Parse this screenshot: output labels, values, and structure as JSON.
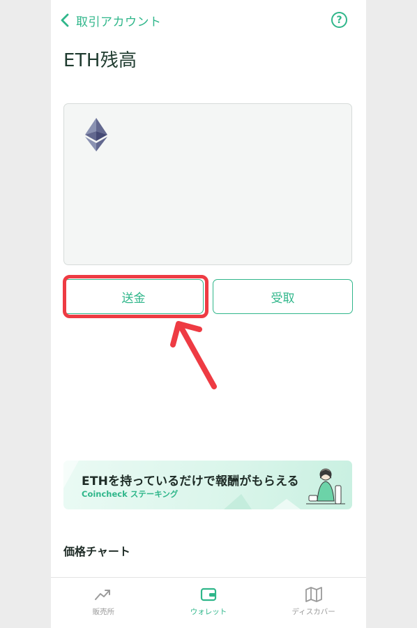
{
  "header": {
    "back_label": "取引アカウント",
    "title": "ETH残高"
  },
  "actions": {
    "send_label": "送金",
    "receive_label": "受取"
  },
  "banner": {
    "headline": "ETHを持っているだけで報酬がもらえる",
    "subtitle": "Coincheck ステーキング"
  },
  "section": {
    "price_chart_title": "価格チャート"
  },
  "tabbar": {
    "items": [
      {
        "label": "販売所",
        "icon": "trend-icon",
        "active": false
      },
      {
        "label": "ウォレット",
        "icon": "wallet-icon",
        "active": true
      },
      {
        "label": "ディスカバー",
        "icon": "map-icon",
        "active": false
      }
    ]
  },
  "colors": {
    "accent": "#2fb68a",
    "annotation": "#ee3b43",
    "title_text": "#1f3b2f"
  }
}
